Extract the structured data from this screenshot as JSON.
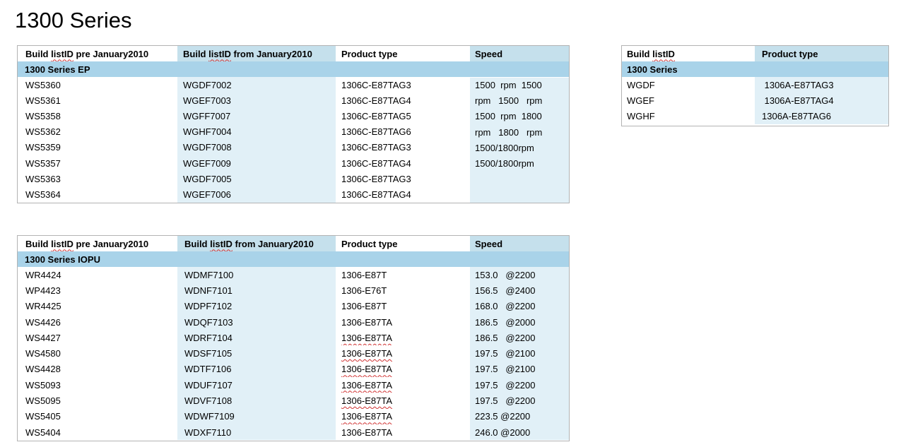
{
  "page": {
    "title": "1300 Series"
  },
  "ep_table": {
    "headers": [
      "Build listID pre January2010",
      "Build listID from January2010",
      "Product type",
      "Speed"
    ],
    "section": "1300 Series EP",
    "rows": [
      [
        "WS5360",
        "WGDF7002",
        "1306C-E87TAG3"
      ],
      [
        "WS5361",
        "WGEF7003",
        "1306C-E87TAG4"
      ],
      [
        "WS5358",
        "WGFF7007",
        "1306C-E87TAG5"
      ],
      [
        "WS5362",
        "WGHF7004",
        "1306C-E87TAG6"
      ],
      [
        "WS5359",
        "WGDF7008",
        "1306C-E87TAG3"
      ],
      [
        "WS5357",
        "WGEF7009",
        "1306C-E87TAG4"
      ],
      [
        "WS5363",
        "WGDF7005",
        "1306C-E87TAG3"
      ],
      [
        "WS5364",
        "WGEF7006",
        "1306C-E87TAG4"
      ]
    ],
    "speed_lines": [
      "1500  rpm  1500",
      "rpm   1500   rpm",
      "1500  rpm  1800",
      "rpm   1800   rpm",
      "1500/1800rpm",
      "1500/1800rpm"
    ]
  },
  "series_table": {
    "headers": [
      "Build listID",
      "Product type"
    ],
    "section": "1300 Series",
    "rows": [
      [
        "WGDF",
        " 1306A-E87TAG3"
      ],
      [
        "WGEF",
        " 1306A-E87TAG4"
      ],
      [
        "WGHF",
        "1306A-E87TAG6"
      ]
    ]
  },
  "iopu_table": {
    "headers": [
      "Build listID pre January2010",
      "Build listID from January2010",
      "Product type",
      "Speed"
    ],
    "section": "1300 Series IOPU",
    "rows": [
      [
        "WR4424",
        "WDMF7100",
        "1306-E87T",
        "153.0   @2200"
      ],
      [
        "WP4423",
        "WDNF7101",
        "1306-E76T",
        "156.5   @2400"
      ],
      [
        "WR4425",
        "WDPF7102",
        "1306-E87T",
        "168.0   @2200"
      ],
      [
        "WS4426",
        "WDQF7103",
        "1306-E87TA",
        "186.5   @2000"
      ],
      [
        "WS4427",
        "WDRF7104",
        "1306-E87TA",
        "186.5   @2200"
      ],
      [
        "WS4580",
        "WDSF7105",
        "1306-E87TA",
        "197.5   @2100"
      ],
      [
        "WS4428",
        "WDTF7106",
        "1306-E87TA",
        "197.5   @2100"
      ],
      [
        "WS5093",
        "WDUF7107",
        "1306-E87TA",
        "197.5   @2200"
      ],
      [
        "WS5095",
        "WDVF7108",
        "1306-E87TA",
        "197.5   @2200"
      ],
      [
        "WS5405",
        "WDWF7109",
        "1306-E87TA",
        "223.5 @2200"
      ],
      [
        "WS5404",
        "WDXF7110",
        "1306-E87TA",
        "246.0 @2000"
      ]
    ]
  }
}
